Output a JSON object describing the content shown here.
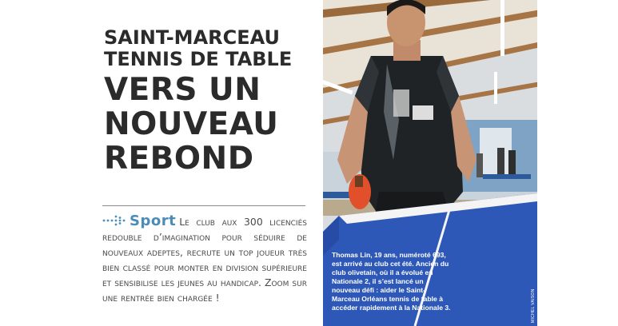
{
  "article": {
    "kicker_line1": "Saint-Marceau",
    "kicker_line2": "tennis de table",
    "title_line1": "Vers un",
    "title_line2": "nouveau",
    "title_line3": "rebond",
    "section": "Sport",
    "standfirst": "Le club aux 300 licenciés redouble d’imagination pour séduire de nouveaux adeptes, recrute un top joueur très bien classé pour monter en division supérieure et sensibilise les jeunes au handicap. Zoom sur une rentrée bien chargée !",
    "caption": "Thomas Lin, 19 ans, numéroté 693, est arrivé au club cet été. Ancien du club olivetain, où il a évolué en Nationale 2, il s’est lancé un nouveau défi : aider le Saint-Marceau Orléans tennis de table à accéder rapidement à la Nationale 3.",
    "photo_credit": "MICHEL VAISON"
  },
  "colors": {
    "section_accent": "#4b8db8",
    "headline": "#2b2b2b"
  },
  "icons": {
    "section_marker": "dot-arrow-icon"
  }
}
